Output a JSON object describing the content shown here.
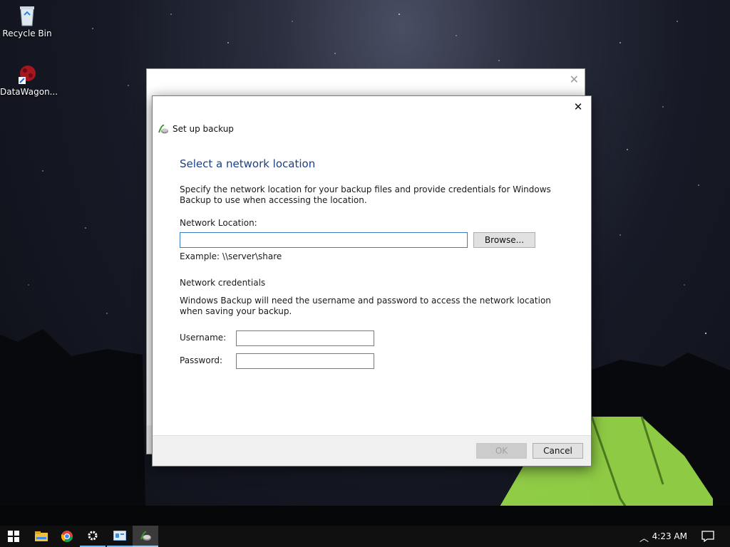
{
  "desktop": {
    "icons": [
      {
        "label": "Recycle Bin",
        "icon": "recycle-bin-icon"
      },
      {
        "label": "DataWagon...",
        "icon": "datawagon-shortcut-icon"
      }
    ]
  },
  "dialog": {
    "title": "Set up backup",
    "heading": "Select a network location",
    "description": "Specify the network location for your backup files and provide credentials for Windows Backup to use when accessing the location.",
    "network_location_label": "Network Location:",
    "network_location_value": "",
    "browse_label": "Browse...",
    "example_text": "Example: \\\\server\\share",
    "credentials_heading": "Network credentials",
    "credentials_description": "Windows Backup will need the username and password to access the network location when saving your backup.",
    "username_label": "Username:",
    "username_value": "",
    "password_label": "Password:",
    "password_value": "",
    "ok_label": "OK",
    "cancel_label": "Cancel"
  },
  "taskbar": {
    "items": [
      "start-icon",
      "file-explorer-icon",
      "chrome-icon",
      "settings-icon",
      "control-panel-icon",
      "backup-icon"
    ],
    "clock": "4:23 AM"
  },
  "colors": {
    "heading": "#1c3f84",
    "focus_border": "#3a7cc6",
    "taskbar": "#101010",
    "tent_green": "#9de04a"
  }
}
